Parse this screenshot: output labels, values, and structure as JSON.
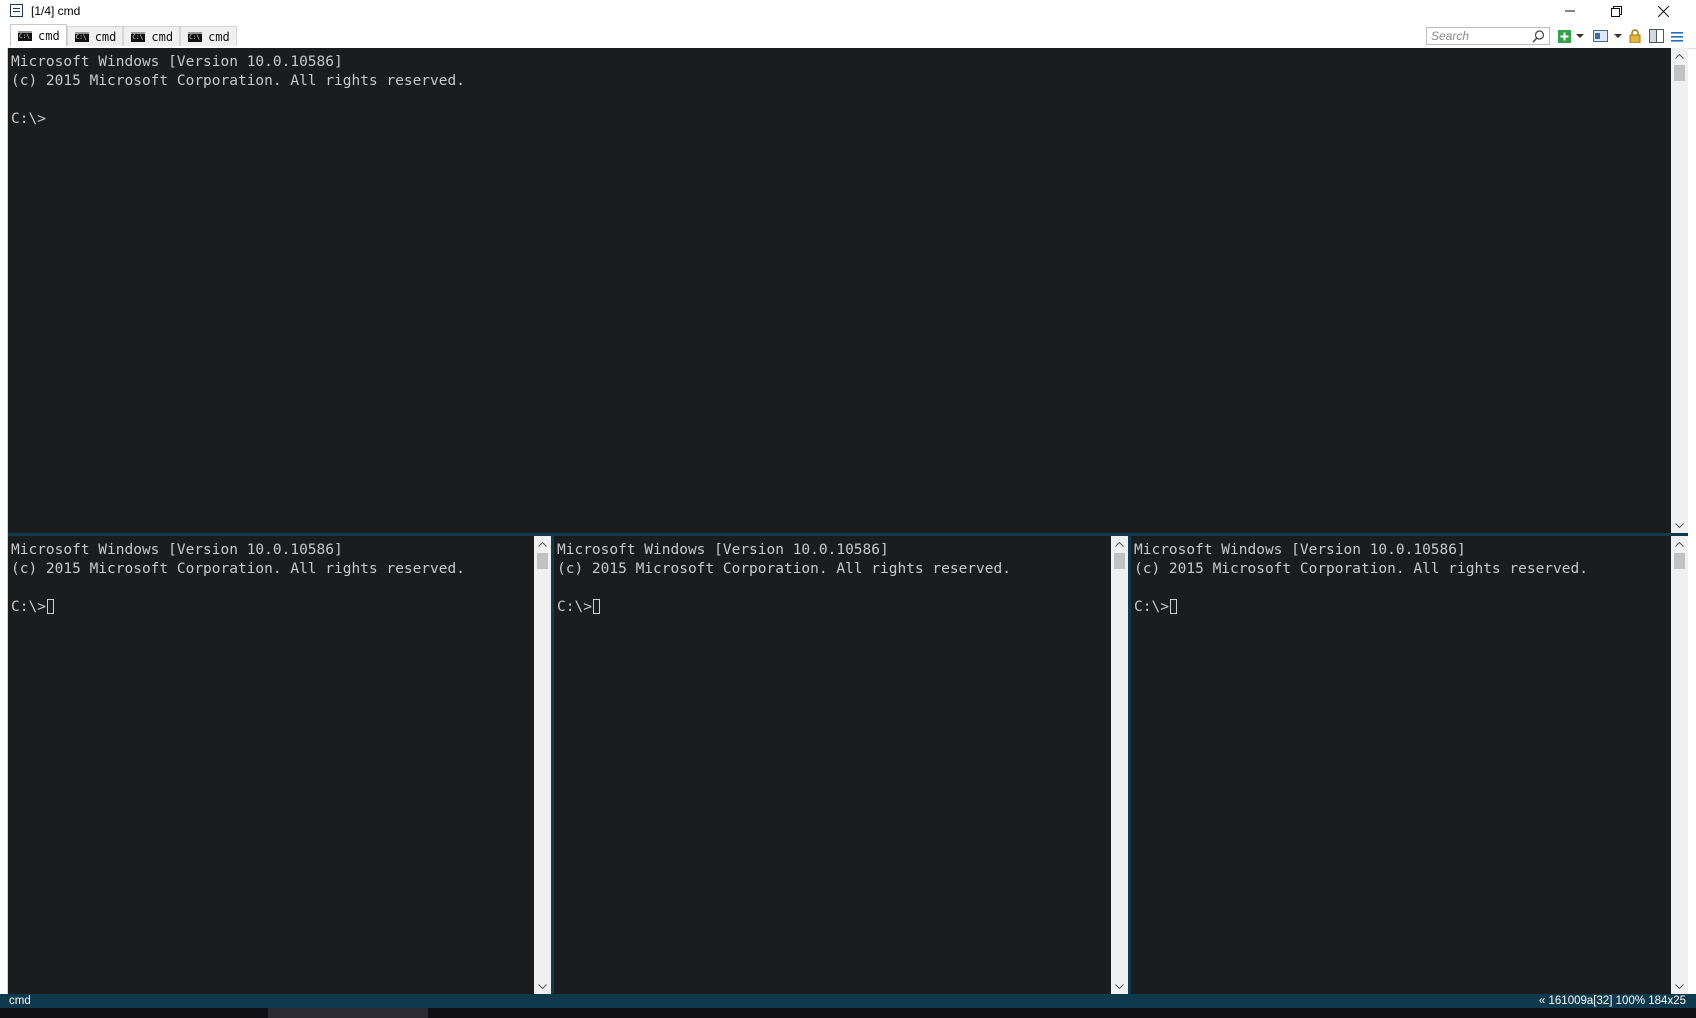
{
  "window": {
    "title": "[1/4] cmd"
  },
  "tabs": [
    {
      "label": "cmd",
      "active": true
    },
    {
      "label": "cmd",
      "active": false
    },
    {
      "label": "cmd",
      "active": false
    },
    {
      "label": "cmd",
      "active": false
    }
  ],
  "search": {
    "placeholder": "Search"
  },
  "toolbar_icons": [
    "new-console-icon",
    "dropdown-arrow-icon",
    "layout-icon",
    "dropdown-arrow-icon",
    "lock-icon",
    "split-view-icon",
    "menu-icon"
  ],
  "consoles": {
    "top": {
      "line1": "Microsoft Windows [Version 10.0.10586]",
      "line2": "(c) 2015 Microsoft Corporation. All rights reserved.",
      "prompt": "C:\\>"
    },
    "bottom_left": {
      "line1": "Microsoft Windows [Version 10.0.10586]",
      "line2": "(c) 2015 Microsoft Corporation. All rights reserved.",
      "prompt": "C:\\>"
    },
    "bottom_middle": {
      "line1": "Microsoft Windows [Version 10.0.10586]",
      "line2": "(c) 2015 Microsoft Corporation. All rights reserved.",
      "prompt": "C:\\>"
    },
    "bottom_right": {
      "line1": "Microsoft Windows [Version 10.0.10586]",
      "line2": "(c) 2015 Microsoft Corporation. All rights reserved.",
      "prompt": "C:\\>"
    }
  },
  "statusbar": {
    "left": "cmd",
    "right": "« 161009a[32]  100%  184x25"
  },
  "colors": {
    "console_bg": "#1b1c1e",
    "console_text": "#c8c8c8",
    "statusbar_bg": "#0f3a4d",
    "splitter": "#0e3a4a"
  }
}
